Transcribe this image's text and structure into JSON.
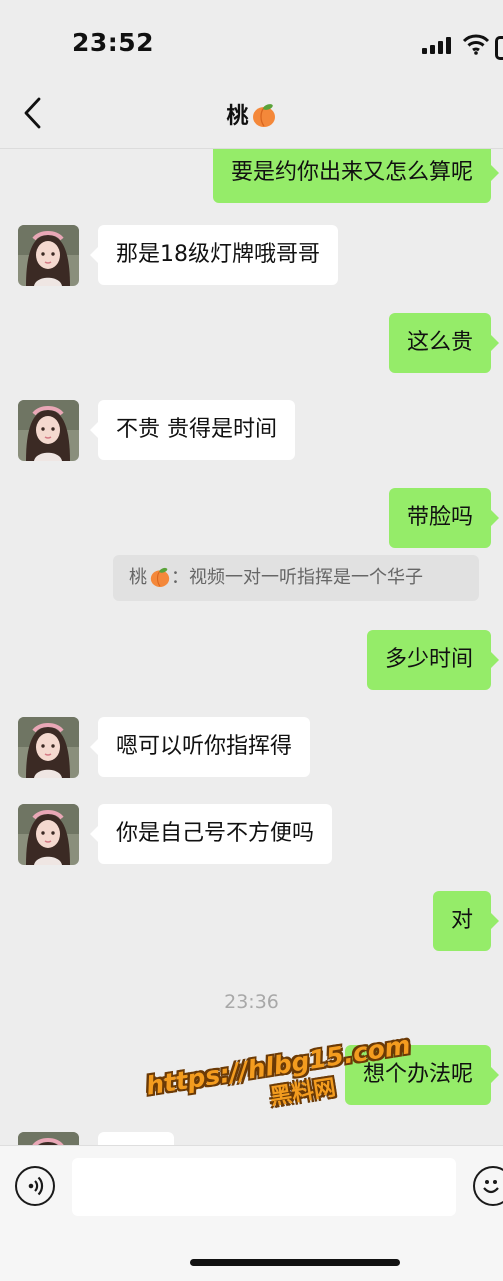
{
  "status_bar": {
    "time": "23:52"
  },
  "header": {
    "title": "桃"
  },
  "messages": [
    {
      "side": "out",
      "text": "要是约你出来又怎么算呢"
    },
    {
      "side": "in",
      "text": "那是18级灯牌哦哥哥"
    },
    {
      "side": "out",
      "text": "这么贵"
    },
    {
      "side": "in",
      "text": "不贵 贵得是时间"
    },
    {
      "side": "out",
      "text": "带脸吗"
    },
    {
      "side": "out",
      "text": "多少时间"
    },
    {
      "side": "in",
      "text": "嗯可以听你指挥得"
    },
    {
      "side": "in",
      "text": "你是自己号不方便吗"
    },
    {
      "side": "out",
      "text": "对"
    },
    {
      "side": "out",
      "text": "想个办法呢"
    }
  ],
  "quote": {
    "sender": "桃",
    "text": "视频一对一听指挥是一个华子"
  },
  "timestamp": "23:36",
  "watermark": {
    "url": "https://hlbg15.com",
    "label": "黑料网"
  },
  "icons": {
    "back": "chevron-left-icon",
    "voice": "voice-icon",
    "emoji": "emoji-icon",
    "peach": "peach-emoji-icon"
  },
  "colors": {
    "outgoing_bubble": "#95ec69",
    "incoming_bubble": "#ffffff",
    "background": "#ededed",
    "watermark": "#f39c1f"
  }
}
